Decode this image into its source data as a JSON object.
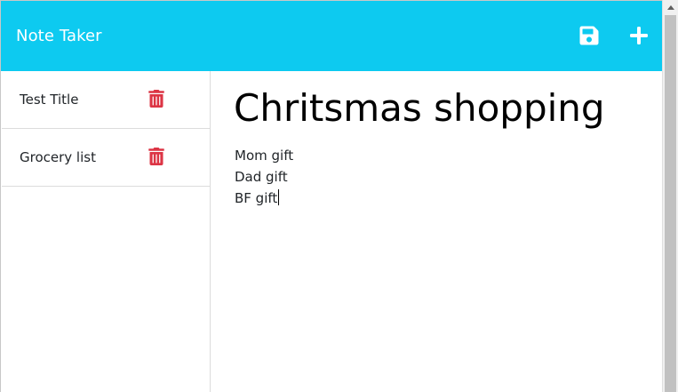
{
  "app": {
    "brand": "Note Taker"
  },
  "toolbar": {
    "save_icon": "save-icon",
    "new_icon": "plus-icon",
    "colors": {
      "navbar": "#0dcaf0",
      "icon": "#ffffff"
    }
  },
  "notes": [
    {
      "title": "Test Title",
      "delete_icon": "trash-icon"
    },
    {
      "title": "Grocery list",
      "delete_icon": "trash-icon"
    }
  ],
  "trash_color": "#dc3545",
  "active_note": {
    "title": "Chritsmas shopping",
    "text": "Mom gift\nDad gift\nBF gift"
  }
}
